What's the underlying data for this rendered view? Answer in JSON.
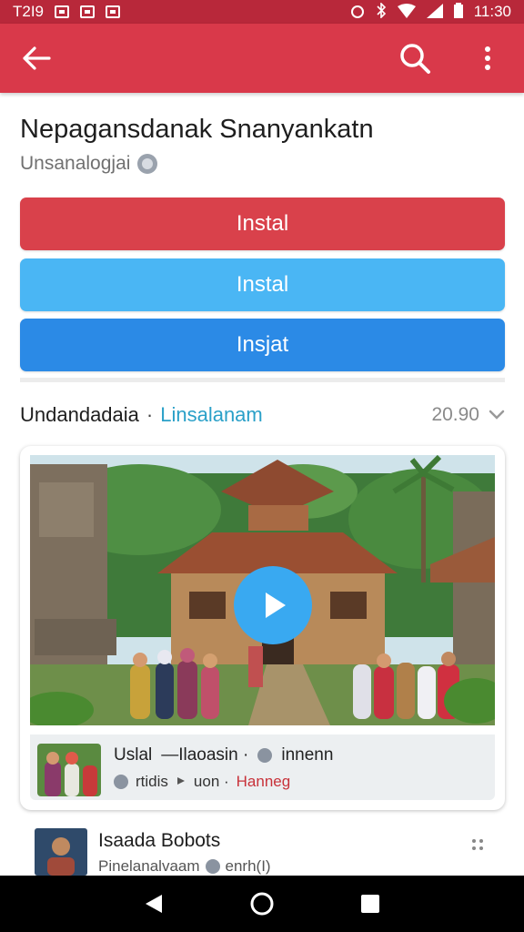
{
  "status_bar": {
    "time_left": "T2I9",
    "time_right": "11:30",
    "icons": [
      "notification-icon",
      "mail-icon",
      "notification-icon",
      "alarm-icon",
      "bluetooth-icon",
      "wifi-icon",
      "signal-icon",
      "battery-icon"
    ]
  },
  "app_bar": {
    "color": "#d9394a",
    "icons": [
      "back-arrow-icon",
      "search-icon",
      "more-vert-icon"
    ]
  },
  "app": {
    "title": "Nepagansdanak Snanyankatn",
    "subtitle": "Unsanalogjai"
  },
  "buttons": {
    "primary_label": "Instal",
    "secondary_label": "Instal",
    "tertiary_label": "Insjat",
    "colors": [
      "#d9414b",
      "#4ab6f4",
      "#2b8ae6"
    ]
  },
  "section": {
    "title": "Undandadaia",
    "separator": "·",
    "link": "Linsalanam",
    "count": "20.90"
  },
  "video_card": {
    "meta_title": "Uslal",
    "meta_part2": "—Ilaoasin ·",
    "meta_part3": "innenn",
    "meta_sub1": "rtidis",
    "meta_sub2": "uon ·",
    "meta_link": "Hanneg"
  },
  "list_item": {
    "title": "Isaada Bobots",
    "subtitle": "Pinelanalvaam",
    "subtitle2": "enrh(I)"
  }
}
